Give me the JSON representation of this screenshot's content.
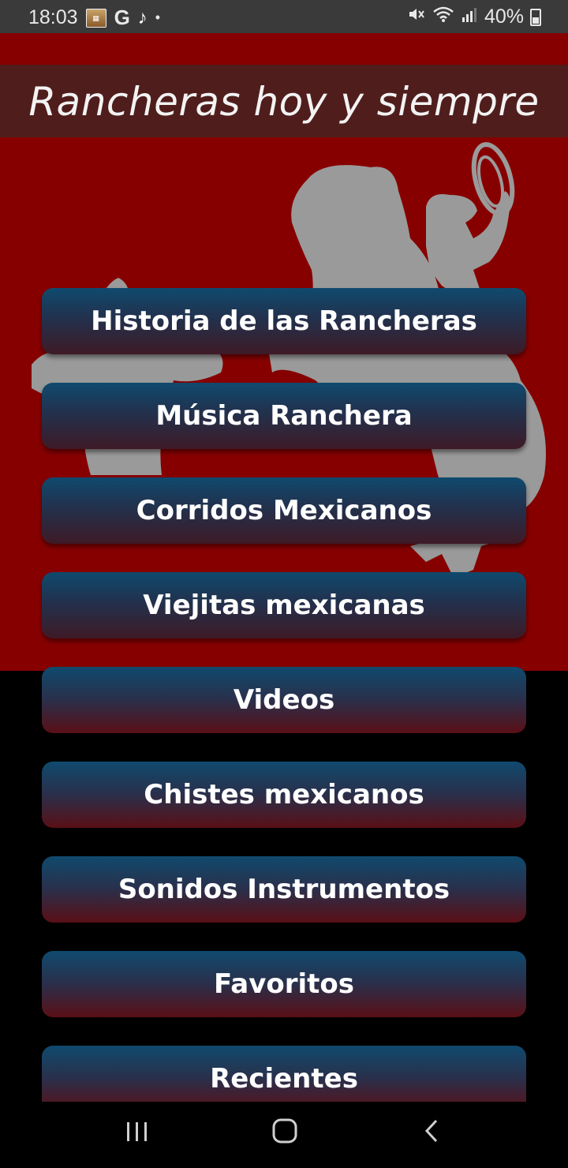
{
  "status_bar": {
    "time": "18:03",
    "battery": "40%",
    "icons": [
      "app-notification-icon",
      "google-icon",
      "tiktok-icon",
      "dot-icon",
      "mute-icon",
      "wifi-icon",
      "signal-icon",
      "battery-icon"
    ]
  },
  "header": {
    "title": "Rancheras hoy y siempre"
  },
  "menu": {
    "items": [
      {
        "label": "Historia de las Rancheras"
      },
      {
        "label": "Música Ranchera"
      },
      {
        "label": "Corridos Mexicanos"
      },
      {
        "label": "Viejitas mexicanas"
      },
      {
        "label": "Videos"
      },
      {
        "label": "Chistes mexicanos"
      },
      {
        "label": "Sonidos Instrumentos"
      },
      {
        "label": "Favoritos"
      },
      {
        "label": "Recientes"
      }
    ]
  },
  "nav_bar": {
    "icons": [
      "recent-apps-icon",
      "home-icon",
      "back-icon"
    ]
  },
  "colors": {
    "hero_red": "#870000",
    "title_band": "#4f1e1c",
    "status_bar": "#3a3a3a",
    "button_top": "#0f4a6e",
    "button_bottom": "#5a0f16"
  }
}
